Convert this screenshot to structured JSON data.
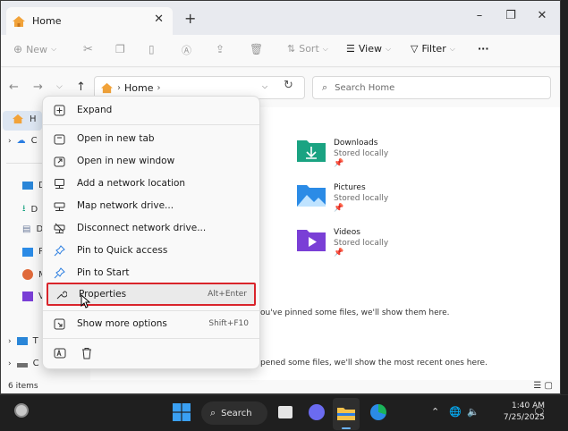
{
  "window": {
    "tab_title": "Home",
    "tab_close": "✕",
    "new_tab": "+",
    "minimize": "–",
    "maximize": "❐",
    "close": "✕"
  },
  "toolbar": {
    "new_label": "New",
    "sort_label": "Sort",
    "view_label": "View",
    "filter_label": "Filter",
    "more_label": "···"
  },
  "address": {
    "path_home": "Home",
    "search_placeholder": "Search Home"
  },
  "nav": {
    "items": [
      {
        "icon": "home-icon",
        "label": "H"
      },
      {
        "icon": "cloud-icon",
        "label": "C"
      },
      {
        "icon": "desktop-icon",
        "label": "D"
      },
      {
        "icon": "download-icon",
        "label": "D"
      },
      {
        "icon": "documents-icon",
        "label": "D"
      },
      {
        "icon": "pictures-icon",
        "label": "P"
      },
      {
        "icon": "music-icon",
        "label": "M"
      },
      {
        "icon": "videos-icon",
        "label": "V"
      },
      {
        "icon": "this-pc-icon",
        "label": "T"
      },
      {
        "icon": "drive-icon",
        "label": "C"
      }
    ]
  },
  "quick_access": [
    {
      "name": "Downloads",
      "status": "Stored locally",
      "color": "#1aa382"
    },
    {
      "name": "Pictures",
      "status": "Stored locally",
      "color": "#2b8be6"
    },
    {
      "name": "Videos",
      "status": "Stored locally",
      "color": "#7a3fd6"
    }
  ],
  "content": {
    "favorites_empty": "ou've pinned some files, we'll show them here.",
    "recent_empty": "pened some files, we'll show the most recent ones here."
  },
  "status": {
    "item_count": "6 items"
  },
  "context_menu": {
    "items": [
      {
        "label": "Expand",
        "icon": "expand-icon",
        "shortcut": ""
      },
      {
        "label": "Open in new tab",
        "icon": "new-tab-icon",
        "shortcut": ""
      },
      {
        "label": "Open in new window",
        "icon": "new-window-icon",
        "shortcut": ""
      },
      {
        "label": "Add a network location",
        "icon": "network-location-icon",
        "shortcut": ""
      },
      {
        "label": "Map network drive...",
        "icon": "map-drive-icon",
        "shortcut": ""
      },
      {
        "label": "Disconnect network drive...",
        "icon": "disconnect-drive-icon",
        "shortcut": ""
      },
      {
        "label": "Pin to Quick access",
        "icon": "pin-icon",
        "shortcut": ""
      },
      {
        "label": "Pin to Start",
        "icon": "pin-start-icon",
        "shortcut": ""
      },
      {
        "label": "Properties",
        "icon": "wrench-icon",
        "shortcut": "Alt+Enter"
      },
      {
        "label": "Show more options",
        "icon": "more-options-icon",
        "shortcut": "Shift+F10"
      }
    ],
    "highlight_color": "#d9242b"
  },
  "taskbar": {
    "search_label": "Search",
    "time": "1:40 AM",
    "date": "7/25/2025"
  }
}
